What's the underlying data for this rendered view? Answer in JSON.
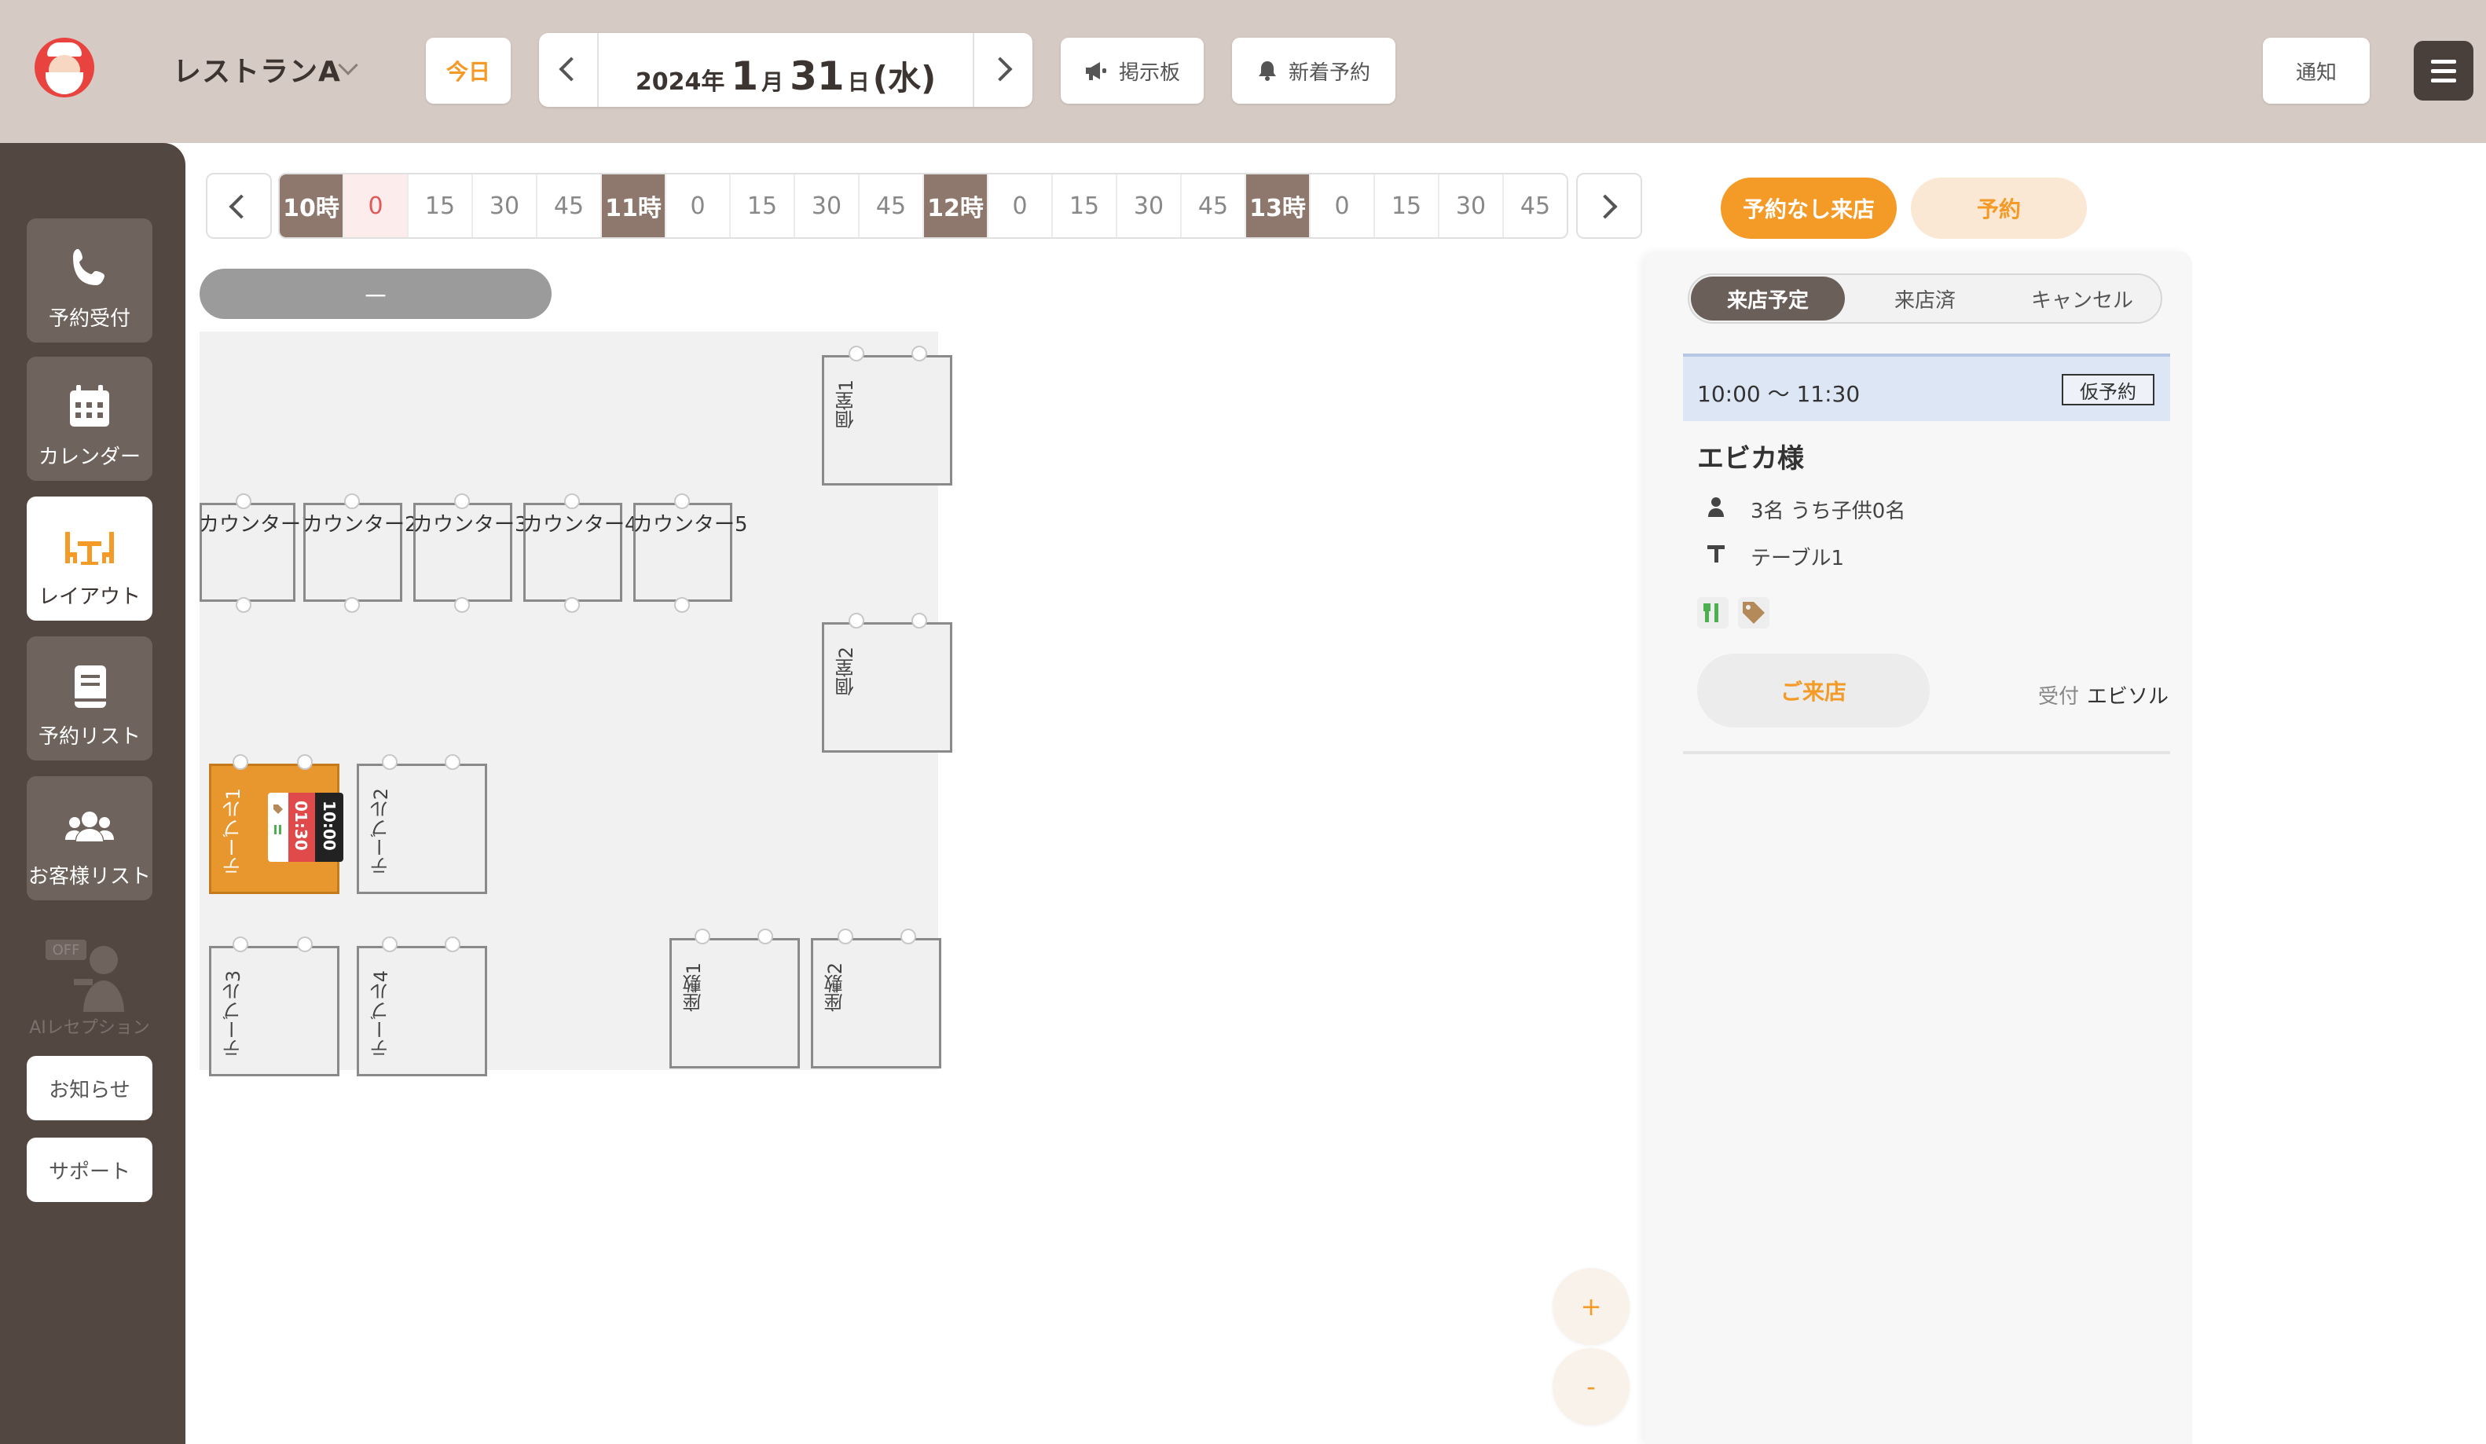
{
  "header": {
    "store_name": "レストランA",
    "today_label": "今日",
    "date": {
      "year": "2024年",
      "month_num": "1",
      "month_unit": "月",
      "day_num": "31",
      "day_unit": "日",
      "dow": "(水)"
    },
    "board_label": "掲示板",
    "new_reservation_label": "新着予約",
    "notice_label": "通知"
  },
  "sidebar": {
    "items": [
      {
        "label": "予約受付",
        "icon": "phone-icon"
      },
      {
        "label": "カレンダー",
        "icon": "calendar-icon"
      },
      {
        "label": "レイアウト",
        "icon": "table-layout-icon",
        "active": true
      },
      {
        "label": "予約リスト",
        "icon": "book-icon"
      },
      {
        "label": "お客様リスト",
        "icon": "users-icon"
      }
    ],
    "ai_label": "AIレセプション",
    "ai_badge": "OFF",
    "news_label": "お知らせ",
    "support_label": "サポート"
  },
  "timeline": {
    "cells": [
      "10時",
      "0",
      "15",
      "30",
      "45",
      "11時",
      "0",
      "15",
      "30",
      "45",
      "12時",
      "0",
      "15",
      "30",
      "45",
      "13時",
      "0",
      "15",
      "30",
      "45"
    ],
    "current_index": 1
  },
  "floor": {
    "section_label": "－",
    "tables": {
      "private1": "個室1",
      "private2": "個室2",
      "counter1": "カウンター1",
      "counter2": "カウンター2",
      "counter3": "カウンター3",
      "counter4": "カウンター4",
      "counter5": "カウンター5",
      "table1": "テーブル1",
      "table2": "テーブル2",
      "table3": "テーブル3",
      "table4": "テーブル4",
      "zashiki1": "座敷1",
      "zashiki2": "座敷2"
    },
    "table1_reservation": {
      "duration": "01:30",
      "start": "10:00"
    },
    "zoom_in": "+",
    "zoom_out": "-"
  },
  "right_panel": {
    "walkin_label": "予約なし来店",
    "reserve_label": "予約",
    "tabs": [
      "来店予定",
      "来店済",
      "キャンセル"
    ],
    "selected_tab": 0,
    "card": {
      "time": "10:00 ～ 11:30",
      "badge": "仮予約",
      "name": "エビカ様",
      "guests": "3名 うち子供0名",
      "table": "テーブル1",
      "arrive_label": "ご来店",
      "reception_key": "受付",
      "reception_value": "エビソル"
    }
  },
  "colors": {
    "accent": "#f39a27",
    "topbar": "#d6cac4",
    "sidebar": "#534741",
    "hour_cell": "#8e786d",
    "occupied": "#e8962e"
  }
}
